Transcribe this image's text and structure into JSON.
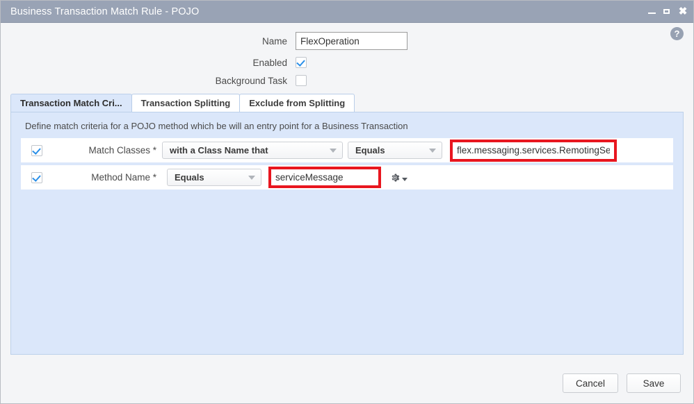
{
  "window": {
    "title": "Business Transaction Match Rule - POJO",
    "controls": {
      "minimize": "_",
      "maximize": "□",
      "close": "✖"
    }
  },
  "help": {
    "label": "?"
  },
  "form": {
    "name_label": "Name",
    "name_value": "FlexOperation",
    "name_placeholder": "",
    "enabled_label": "Enabled",
    "enabled_checked": "true",
    "background_task_label": "Background Task",
    "background_task_checked": "false"
  },
  "tabs": [
    {
      "label": "Transaction Match Cri...",
      "active": "true"
    },
    {
      "label": "Transaction Splitting",
      "active": "false"
    },
    {
      "label": "Exclude from Splitting",
      "active": "false"
    }
  ],
  "panel": {
    "description": "Define match criteria for a POJO method which be will an entry point for a Business Transaction",
    "rows": [
      {
        "checked": "true",
        "label": "Match Classes *",
        "type_dropdown": "with a Class Name that",
        "match_dropdown": "Equals",
        "value": "flex.messaging.services.RemotingService",
        "highlighted": "true"
      },
      {
        "checked": "true",
        "label": "Method Name *",
        "match_dropdown": "Equals",
        "value": "serviceMessage",
        "highlighted": "true",
        "gear_icon": "gear-icon"
      }
    ]
  },
  "footer": {
    "cancel_label": "Cancel",
    "save_label": "Save"
  },
  "colors": {
    "titlebar": "#99a3b5",
    "panel": "#dbe7fa",
    "annotation": "#e8161f",
    "checkbox_check": "#2a8fe8"
  }
}
